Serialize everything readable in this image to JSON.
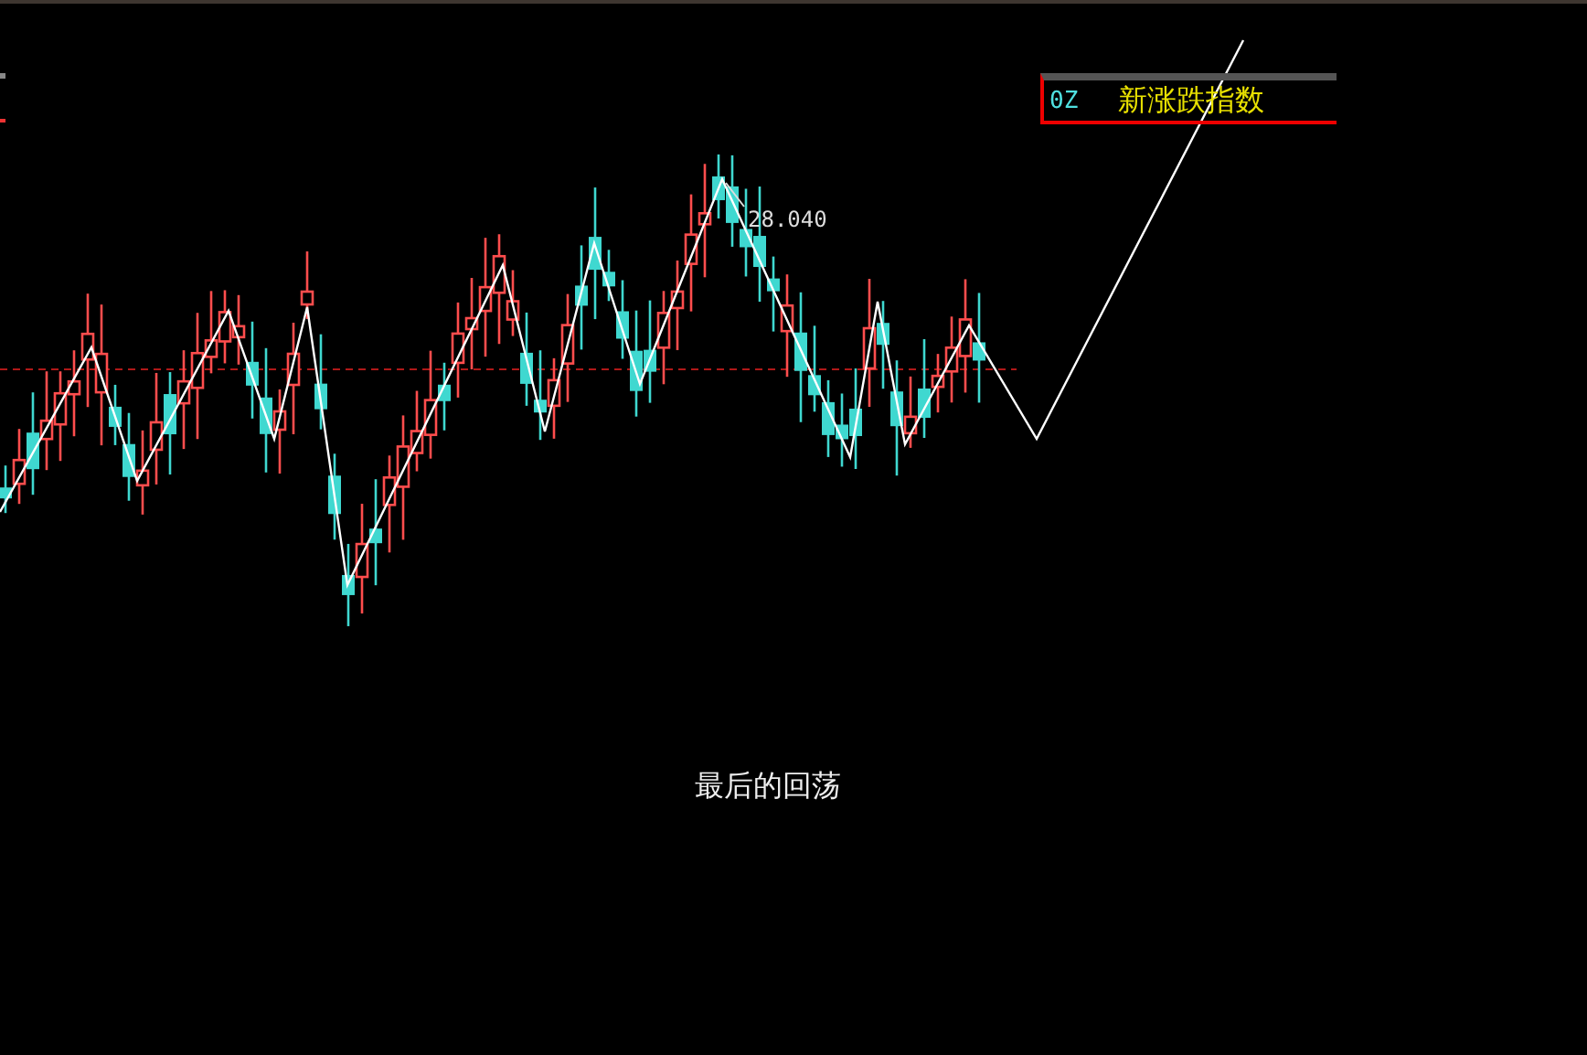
{
  "legend": {
    "code": "0Z",
    "name": "新涨跌指数"
  },
  "price_label": "28.040",
  "caption": "最后的回荡"
}
